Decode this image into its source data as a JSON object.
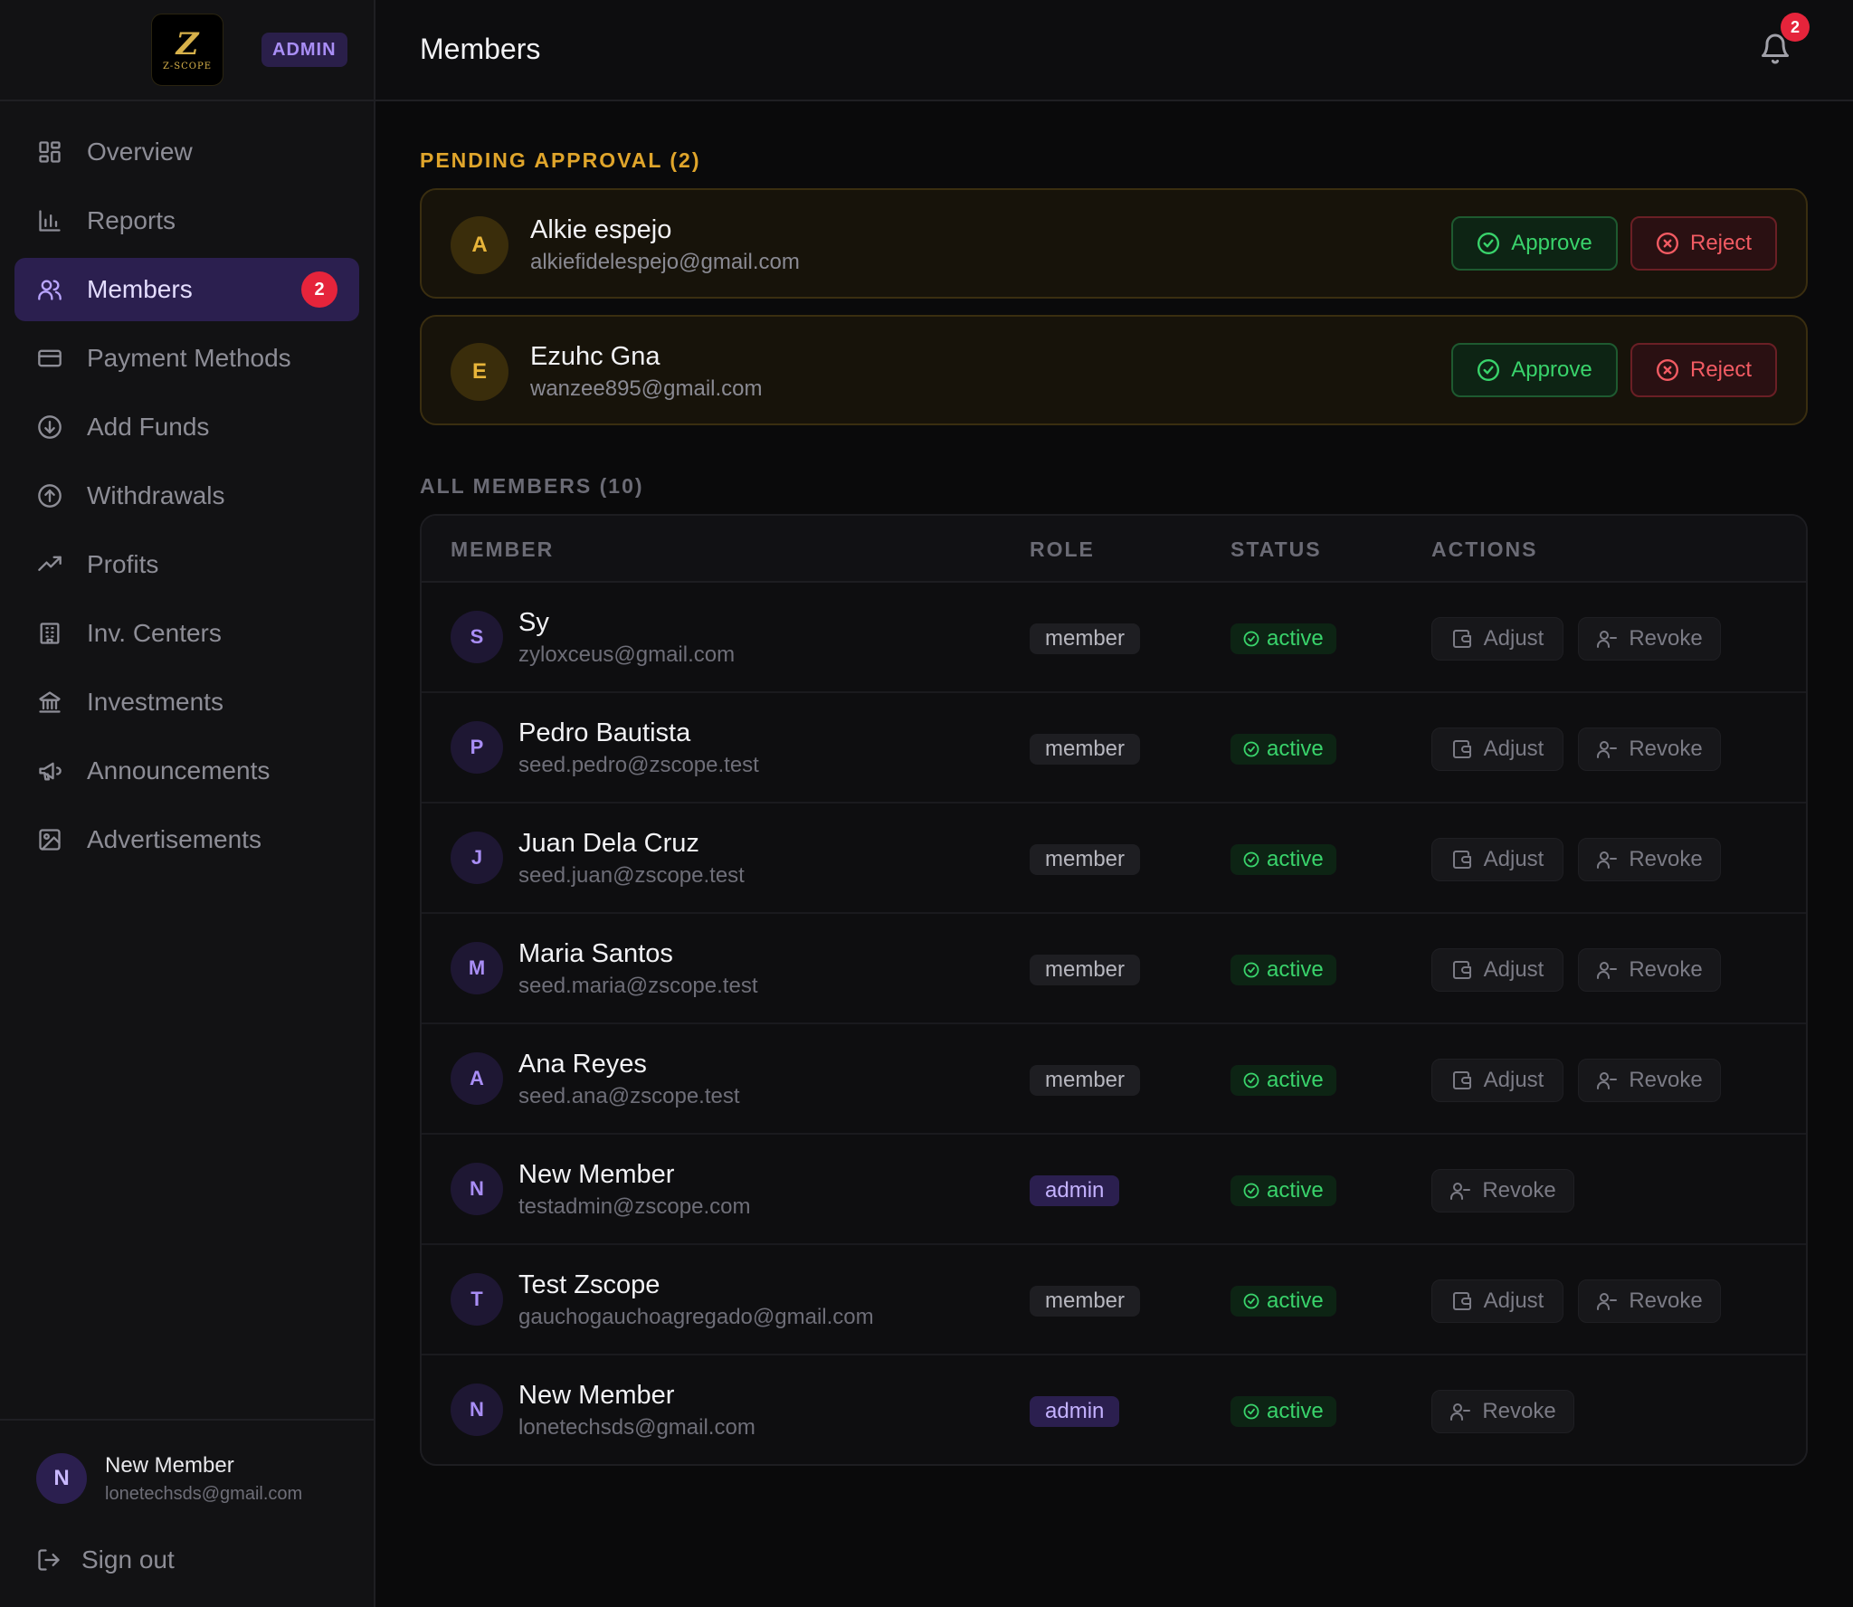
{
  "sidebar": {
    "logo_text": "Z-SCOPE",
    "logo_letter": "Z",
    "role_badge": "ADMIN",
    "items": [
      {
        "label": "Overview",
        "icon": "grid-icon"
      },
      {
        "label": "Reports",
        "icon": "bar-chart-icon"
      },
      {
        "label": "Members",
        "icon": "users-icon",
        "active": true,
        "count": "2"
      },
      {
        "label": "Payment Methods",
        "icon": "credit-card-icon"
      },
      {
        "label": "Add Funds",
        "icon": "arrow-down-circle-icon"
      },
      {
        "label": "Withdrawals",
        "icon": "arrow-up-circle-icon"
      },
      {
        "label": "Profits",
        "icon": "trending-up-icon"
      },
      {
        "label": "Inv. Centers",
        "icon": "building-icon"
      },
      {
        "label": "Investments",
        "icon": "bank-icon"
      },
      {
        "label": "Announcements",
        "icon": "megaphone-icon"
      },
      {
        "label": "Advertisements",
        "icon": "image-icon"
      }
    ],
    "user": {
      "initial": "N",
      "name": "New Member",
      "email": "lonetechsds@gmail.com"
    },
    "signout_label": "Sign out"
  },
  "header": {
    "title": "Members",
    "notification_count": "2"
  },
  "pending": {
    "title": "PENDING APPROVAL (2)",
    "approve_label": "Approve",
    "reject_label": "Reject",
    "items": [
      {
        "initial": "A",
        "name": "Alkie espejo",
        "email": "alkiefidelespejo@gmail.com"
      },
      {
        "initial": "E",
        "name": "Ezuhc Gna",
        "email": "wanzee895@gmail.com"
      }
    ]
  },
  "members": {
    "title": "ALL MEMBERS (10)",
    "columns": [
      "MEMBER",
      "ROLE",
      "STATUS",
      "ACTIONS"
    ],
    "adjust_label": "Adjust",
    "revoke_label": "Revoke",
    "rows": [
      {
        "initial": "S",
        "name": "Sy",
        "email": "zyloxceus@gmail.com",
        "role": "member",
        "status": "active"
      },
      {
        "initial": "P",
        "name": "Pedro Bautista",
        "email": "seed.pedro@zscope.test",
        "role": "member",
        "status": "active"
      },
      {
        "initial": "J",
        "name": "Juan Dela Cruz",
        "email": "seed.juan@zscope.test",
        "role": "member",
        "status": "active"
      },
      {
        "initial": "M",
        "name": "Maria Santos",
        "email": "seed.maria@zscope.test",
        "role": "member",
        "status": "active"
      },
      {
        "initial": "A",
        "name": "Ana Reyes",
        "email": "seed.ana@zscope.test",
        "role": "member",
        "status": "active"
      },
      {
        "initial": "N",
        "name": "New Member",
        "email": "testadmin@zscope.com",
        "role": "admin",
        "status": "active"
      },
      {
        "initial": "T",
        "name": "Test Zscope",
        "email": "gauchogauchoagregado@gmail.com",
        "role": "member",
        "status": "active"
      },
      {
        "initial": "N",
        "name": "New Member",
        "email": "lonetechsds@gmail.com",
        "role": "admin",
        "status": "active"
      }
    ]
  },
  "colors": {
    "accent": "#2b1f4f",
    "pending": "#e0a52b",
    "success": "#39d36b",
    "danger": "#f25b63",
    "badge": "#e5243b"
  }
}
